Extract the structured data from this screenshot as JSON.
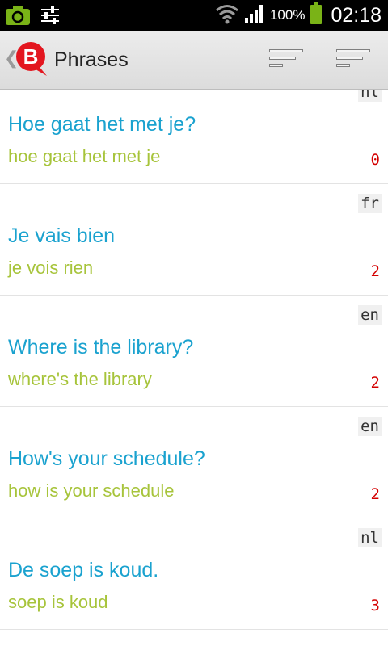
{
  "status_bar": {
    "battery_percent": "100%",
    "time": "02:18",
    "icons": [
      "camera-sync-icon",
      "sliders-icon",
      "wifi-icon",
      "signal-icon",
      "battery-icon"
    ]
  },
  "action_bar": {
    "title": "Phrases",
    "logo_letter": "B",
    "brand_color": "#e3161f",
    "actions": [
      "sort-icon",
      "sort-icon"
    ]
  },
  "phrases": [
    {
      "lang": "nl",
      "text": "Hoe gaat het met je?",
      "transcript": "hoe gaat het met je",
      "score": "0"
    },
    {
      "lang": "fr",
      "text": "Je vais bien",
      "transcript": "je vois rien",
      "score": "2"
    },
    {
      "lang": "en",
      "text": "Where is the library?",
      "transcript": "where's the library",
      "score": "2"
    },
    {
      "lang": "en",
      "text": "How's your schedule?",
      "transcript": "how is your schedule",
      "score": "2"
    },
    {
      "lang": "nl",
      "text": "De soep is koud.",
      "transcript": "soep is koud",
      "score": "3"
    }
  ],
  "colors": {
    "phrase_text": "#1aa2cf",
    "transcript_text": "#a7c43b",
    "score_text": "#d40000"
  }
}
